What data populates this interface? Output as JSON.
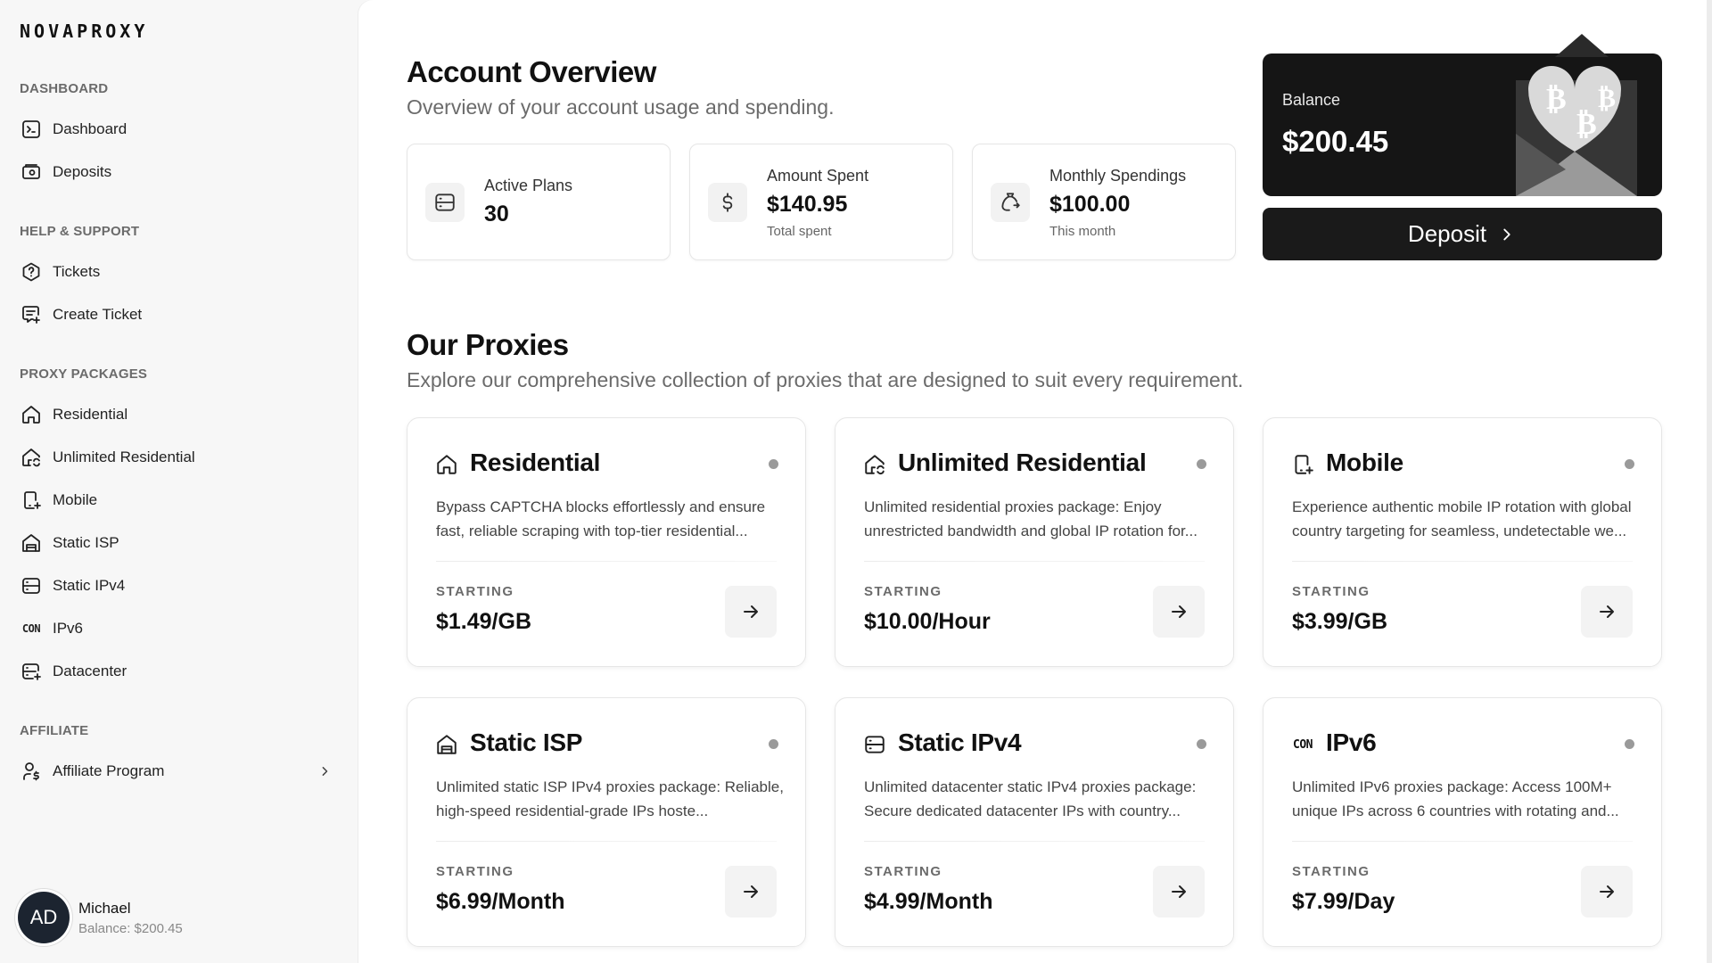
{
  "brand": {
    "logo": "NOVAPROXY"
  },
  "sidebar": {
    "sections": [
      {
        "label": "DASHBOARD",
        "items": [
          {
            "label": "Dashboard",
            "icon": "terminal-icon"
          },
          {
            "label": "Deposits",
            "icon": "wallet-icon"
          }
        ]
      },
      {
        "label": "HELP & SUPPORT",
        "items": [
          {
            "label": "Tickets",
            "icon": "help-circle-icon"
          },
          {
            "label": "Create Ticket",
            "icon": "message-plus-icon"
          }
        ]
      },
      {
        "label": "PROXY PACKAGES",
        "items": [
          {
            "label": "Residential",
            "icon": "home-icon"
          },
          {
            "label": "Unlimited Residential",
            "icon": "home-sync-icon"
          },
          {
            "label": "Mobile",
            "icon": "mobile-icon"
          },
          {
            "label": "Static ISP",
            "icon": "building-icon"
          },
          {
            "label": "Static IPv4",
            "icon": "server-icon"
          },
          {
            "label": "IPv6",
            "icon": "con-icon",
            "icon_text": "CON"
          },
          {
            "label": "Datacenter",
            "icon": "server-plus-icon"
          }
        ]
      },
      {
        "label": "AFFILIATE",
        "items": [
          {
            "label": "Affiliate Program",
            "icon": "user-dollar-icon"
          }
        ]
      }
    ],
    "user": {
      "initials": "AD",
      "name": "Michael",
      "balance": "Balance: $200.45"
    }
  },
  "overview": {
    "title": "Account Overview",
    "subtitle": "Overview of your account usage and spending.",
    "stats": [
      {
        "label": "Active Plans",
        "value": "30",
        "note": "",
        "icon": "server-icon"
      },
      {
        "label": "Amount Spent",
        "value": "$140.95",
        "note": "Total spent",
        "icon": "dollar-icon"
      },
      {
        "label": "Monthly Spendings",
        "value": "$100.00",
        "note": "This month",
        "icon": "money-bag-icon"
      }
    ],
    "balance": {
      "label": "Balance",
      "value": "$200.45"
    },
    "deposit_label": "Deposit"
  },
  "proxies": {
    "title": "Our Proxies",
    "subtitle": "Explore our comprehensive collection of proxies that are designed to suit every requirement.",
    "starting_label": "STARTING",
    "cards": [
      {
        "title": "Residential",
        "icon": "home-icon",
        "desc": "Bypass CAPTCHA blocks effortlessly and ensure fast, reliable scraping with top-tier residential...",
        "price": "$1.49/GB"
      },
      {
        "title": "Unlimited Residential",
        "icon": "home-sync-icon",
        "desc": "Unlimited residential proxies package: Enjoy unrestricted bandwidth and global IP rotation for...",
        "price": "$10.00/Hour"
      },
      {
        "title": "Mobile",
        "icon": "mobile-icon",
        "desc": "Experience authentic mobile IP rotation with global country targeting for seamless, undetectable we...",
        "price": "$3.99/GB"
      },
      {
        "title": "Static ISP",
        "icon": "building-icon",
        "desc": "Unlimited static ISP IPv4 proxies package: Reliable, high-speed residential-grade IPs hoste...",
        "price": "$6.99/Month"
      },
      {
        "title": "Static IPv4",
        "icon": "server-icon",
        "desc": "Unlimited datacenter static IPv4 proxies package: Secure dedicated datacenter IPs with country...",
        "price": "$4.99/Month"
      },
      {
        "title": "IPv6",
        "icon": "con-icon",
        "icon_text": "CON",
        "desc": "Unlimited IPv6 proxies package: Access 100M+ unique IPs across 6 countries with rotating and...",
        "price": "$7.99/Day"
      }
    ]
  }
}
